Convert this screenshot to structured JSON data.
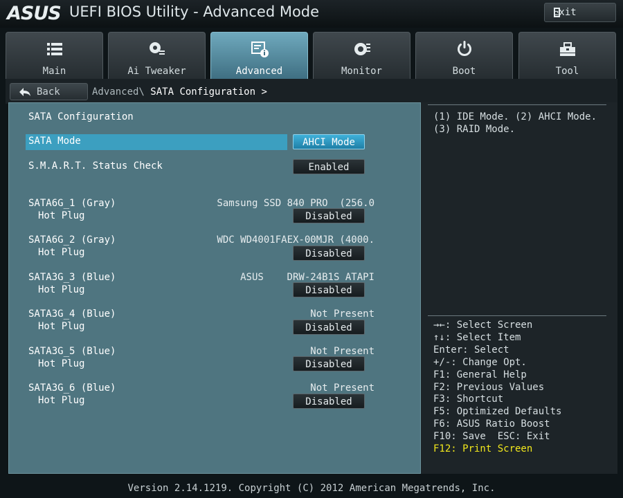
{
  "window": {
    "brand": "ASUS",
    "title": "UEFI BIOS Utility - Advanced Mode",
    "exit_label": "Exit"
  },
  "tabs": [
    {
      "label": "Main",
      "icon": "list-icon"
    },
    {
      "label": "Ai Tweaker",
      "icon": "tweaker-icon"
    },
    {
      "label": "Advanced",
      "icon": "advanced-icon",
      "active": true
    },
    {
      "label": "Monitor",
      "icon": "monitor-icon"
    },
    {
      "label": "Boot",
      "icon": "power-icon"
    },
    {
      "label": "Tool",
      "icon": "tool-icon"
    }
  ],
  "nav": {
    "back_label": "Back",
    "breadcrumb_parent": "Advanced\\",
    "breadcrumb_current": "SATA Configuration >"
  },
  "panel": {
    "section_title": "SATA Configuration",
    "sata_mode": {
      "label": "SATA Mode",
      "value": "AHCI Mode"
    },
    "smart": {
      "label": "S.M.A.R.T. Status Check",
      "value": "Enabled"
    },
    "ports": [
      {
        "name": "SATA6G_1 (Gray)",
        "device": "Samsung SSD 840 PRO  (256.0",
        "hot_plug_label": "Hot Plug",
        "hot_plug": "Disabled"
      },
      {
        "name": "SATA6G_2 (Gray)",
        "device": "WDC WD4001FAEX-00MJR (4000.",
        "hot_plug_label": "Hot Plug",
        "hot_plug": "Disabled"
      },
      {
        "name": "SATA3G_3 (Blue)",
        "device": "ASUS    DRW-24B1S ATAPI",
        "hot_plug_label": "Hot Plug",
        "hot_plug": "Disabled"
      },
      {
        "name": "SATA3G_4 (Blue)",
        "device": "Not Present",
        "hot_plug_label": "Hot Plug",
        "hot_plug": "Disabled"
      },
      {
        "name": "SATA3G_5 (Blue)",
        "device": "Not Present",
        "hot_plug_label": "Hot Plug",
        "hot_plug": "Disabled"
      },
      {
        "name": "SATA3G_6 (Blue)",
        "device": "Not Present",
        "hot_plug_label": "Hot Plug",
        "hot_plug": "Disabled"
      }
    ]
  },
  "help": {
    "text": "(1) IDE Mode. (2) AHCI Mode. (3) RAID Mode."
  },
  "keys": [
    "→←: Select Screen",
    "↑↓: Select Item",
    "Enter: Select",
    "+/-: Change Opt.",
    "F1: General Help",
    "F2: Previous Values",
    "F3: Shortcut",
    "F5: Optimized Defaults",
    "F6: ASUS Ratio Boost",
    "F10: Save  ESC: Exit",
    "F12: Print Screen"
  ],
  "footer": {
    "version": "Version 2.14.1219. Copyright (C) 2012 American Megatrends, Inc."
  },
  "colors": {
    "panel_bg": "#4f7580",
    "highlight": "#3c9fc0",
    "active_tab": "#6fa9bd",
    "key_highlight": "#f2e81c"
  }
}
